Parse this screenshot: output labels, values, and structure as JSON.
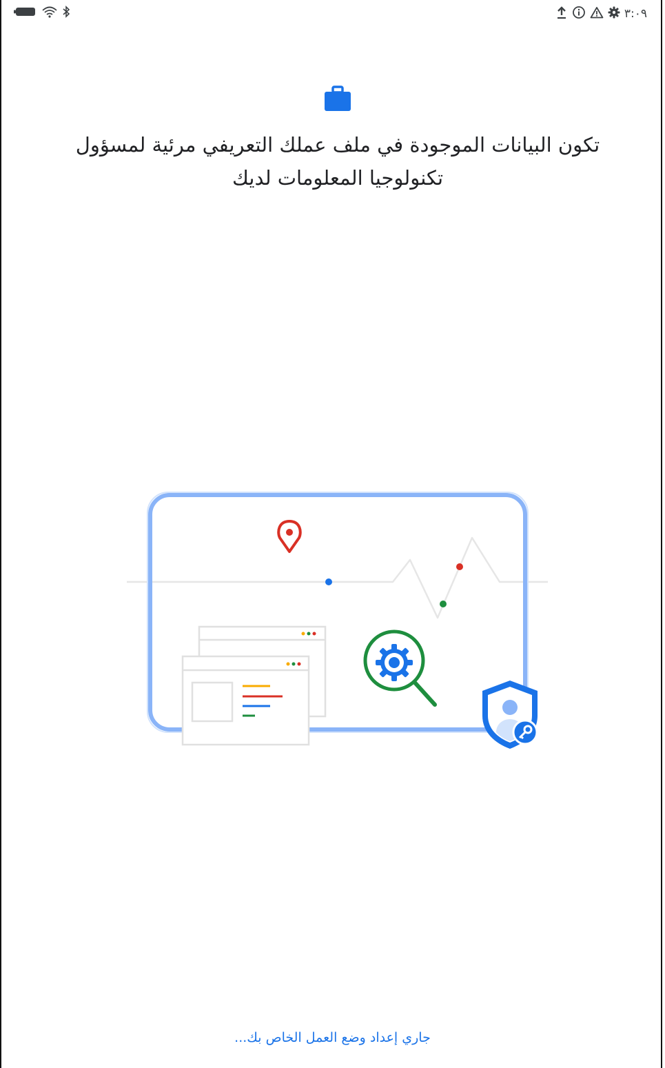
{
  "status_bar": {
    "time": "٣:٠٩",
    "left_icons": [
      "battery-icon",
      "wifi-icon",
      "bluetooth-icon"
    ],
    "right_icons": [
      "upload-icon",
      "info-icon",
      "warning-icon",
      "settings-icon"
    ]
  },
  "header": {
    "icon": "briefcase-icon",
    "title": "تكون البيانات الموجودة في ملف عملك التعريفي مرئية لمسؤول تكنولوجيا المعلومات لديك"
  },
  "illustration": {
    "icons": [
      "location-pin-icon",
      "gear-search-icon",
      "shield-user-key-icon",
      "browser-window-icon"
    ]
  },
  "footer": {
    "status_text": "جاري إعداد وضع العمل الخاص بك..."
  },
  "colors": {
    "accent": "#1a73e8",
    "frame_blue": "#8ab4f8",
    "red": "#d93025",
    "green": "#1e8e3e",
    "yellow": "#f9ab00"
  }
}
